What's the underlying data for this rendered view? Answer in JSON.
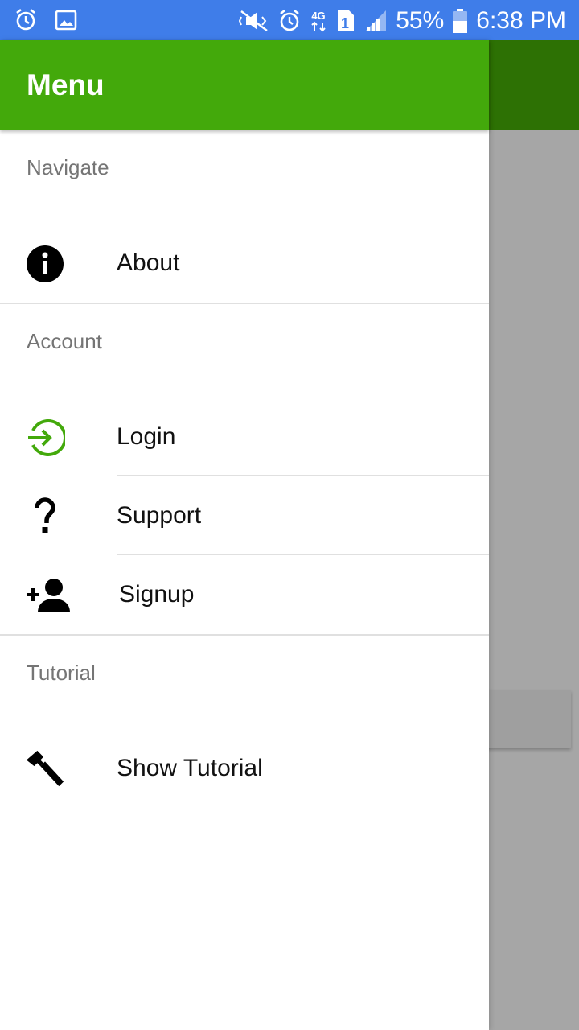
{
  "status_bar": {
    "battery": "55%",
    "time": "6:38 PM",
    "network": "4G",
    "sim": "1",
    "icons": [
      "alarm-icon",
      "image-icon",
      "mute-icon",
      "alarm-icon",
      "network-4g-icon",
      "sim-icon",
      "signal-icon",
      "battery-icon"
    ]
  },
  "drawer": {
    "title": "Menu",
    "sections": [
      {
        "header": "Navigate",
        "items": [
          {
            "label": "About",
            "icon": "info-icon"
          }
        ]
      },
      {
        "header": "Account",
        "items": [
          {
            "label": "Login",
            "icon": "login-icon"
          },
          {
            "label": "Support",
            "icon": "help-icon"
          },
          {
            "label": "Signup",
            "icon": "person-add-icon"
          }
        ]
      },
      {
        "header": "Tutorial",
        "items": [
          {
            "label": "Show Tutorial",
            "icon": "hammer-icon"
          }
        ]
      }
    ]
  },
  "colors": {
    "status_bar": "#3f7de9",
    "drawer_header": "#43a90b",
    "app_bar_dimmed": "#2d7104",
    "scrim": "#a6a6a6",
    "login_icon": "#43a90b",
    "section_header_text": "#757575"
  }
}
